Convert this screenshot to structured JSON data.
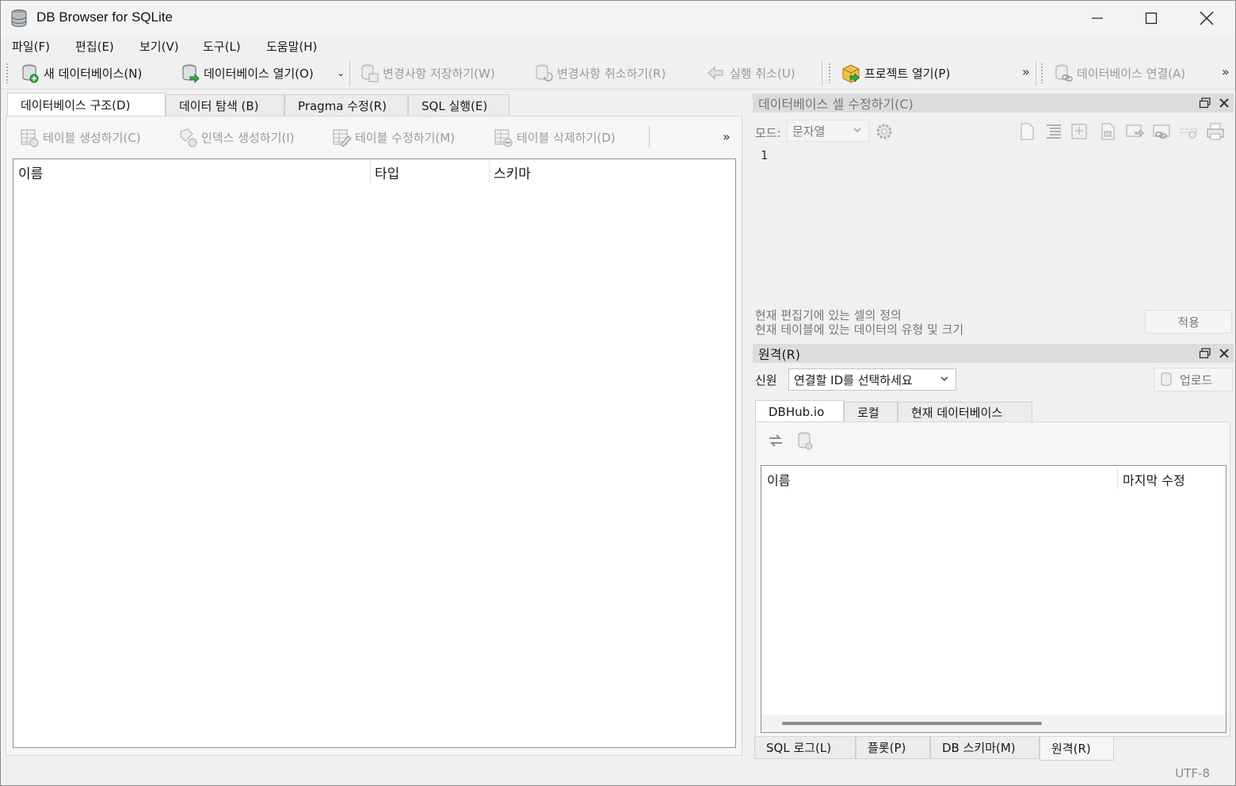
{
  "window": {
    "title": "DB Browser for SQLite"
  },
  "menu": [
    "파일(F)",
    "편집(E)",
    "보기(V)",
    "도구(L)",
    "도움말(H)"
  ],
  "toolbar": {
    "new_db": "새 데이터베이스(N)",
    "open_db": "데이터베이스 열기(O)",
    "write_changes": "변경사항 저장하기(W)",
    "revert_changes": "변경사항 취소하기(R)",
    "undo": "실행 취소(U)",
    "open_project": "프로젝트 열기(P)",
    "attach_db": "데이터베이스 연결(A)",
    "more": "»"
  },
  "main_tabs": [
    "데이터베이스 구조(D)",
    "데이터 탐색 (B)",
    "Pragma 수정(R)",
    "SQL 실행(E)"
  ],
  "structure_toolbar": {
    "create_table": "테이블 생성하기(C)",
    "create_index": "인덱스 생성하기(I)",
    "modify_table": "테이블 수정하기(M)",
    "delete_table": "테이블 삭제하기(D)",
    "more": "»"
  },
  "tree_columns": [
    "이름",
    "타입",
    "스키마"
  ],
  "edit_cell": {
    "title": "데이터베이스 셀 수정하기(C)",
    "mode_label": "모드:",
    "mode_value": "문자열",
    "line_number": "1",
    "info_line1": "현재 편집기에 있는 셀의 정의",
    "info_line2": "현재 테이블에 있는 데이터의 유형 및 크기",
    "apply": "적용"
  },
  "remote": {
    "title": "원격(R)",
    "identity_label": "신원",
    "identity_value": "연결할 ID를 선택하세요",
    "upload": "업로드",
    "tabs": [
      "DBHub.io",
      "로컬",
      "현재 데이터베이스"
    ],
    "columns": [
      "이름",
      "마지막 수정"
    ]
  },
  "bottom_tabs": [
    "SQL 로그(L)",
    "플롯(P)",
    "DB 스키마(M)",
    "원격(R)"
  ],
  "status": {
    "encoding": "UTF-8"
  }
}
